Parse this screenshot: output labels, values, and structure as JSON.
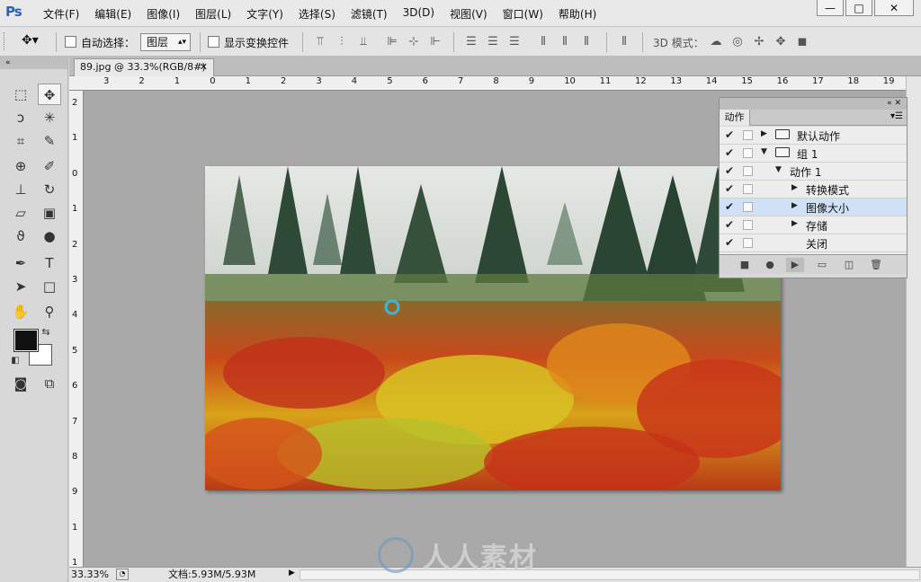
{
  "menubar": {
    "logo": "Ps",
    "items": [
      "文件(F)",
      "编辑(E)",
      "图像(I)",
      "图层(L)",
      "文字(Y)",
      "选择(S)",
      "滤镜(T)",
      "3D(D)",
      "视图(V)",
      "窗口(W)",
      "帮助(H)"
    ],
    "controls": {
      "minimize": "—",
      "maximize": "□",
      "close": "✕"
    }
  },
  "options": {
    "auto_select_label": "自动选择：",
    "auto_select_value": "图层",
    "show_transform_label": "显示变换控件",
    "mode_3d_label": "3D 模式："
  },
  "document": {
    "tab_title": "89.jpg @ 33.3%(RGB/8#)",
    "tab_close": "✕"
  },
  "ruler_top": [
    "3",
    "2",
    "1",
    "0",
    "1",
    "2",
    "3",
    "4",
    "5",
    "6",
    "7",
    "8",
    "9",
    "10",
    "11",
    "12",
    "13",
    "14",
    "15",
    "16",
    "17",
    "18",
    "19"
  ],
  "ruler_left": [
    "2",
    "1",
    "0",
    "1",
    "2",
    "3",
    "4",
    "5",
    "6",
    "7",
    "8",
    "9",
    "1",
    "1"
  ],
  "status": {
    "zoom": "33.33%",
    "doc_info": "文档:5.93M/5.93M"
  },
  "actions_panel": {
    "tab": "动作",
    "rows": [
      {
        "label": "默认动作",
        "level": 0,
        "type": "set",
        "expanded": false
      },
      {
        "label": "组 1",
        "level": 0,
        "type": "set",
        "expanded": true
      },
      {
        "label": "动作 1",
        "level": 1,
        "type": "action",
        "expanded": true
      },
      {
        "label": "转换模式",
        "level": 2,
        "type": "step",
        "expanded": false
      },
      {
        "label": "图像大小",
        "level": 2,
        "type": "step",
        "expanded": false,
        "selected": true
      },
      {
        "label": "存储",
        "level": 2,
        "type": "step",
        "expanded": false
      },
      {
        "label": "关闭",
        "level": 2,
        "type": "step",
        "expanded": false
      }
    ]
  },
  "watermark": "人人素材",
  "colors": {
    "selection_highlight": "#cfe0f7",
    "ps_blue": "#2a63b7"
  }
}
